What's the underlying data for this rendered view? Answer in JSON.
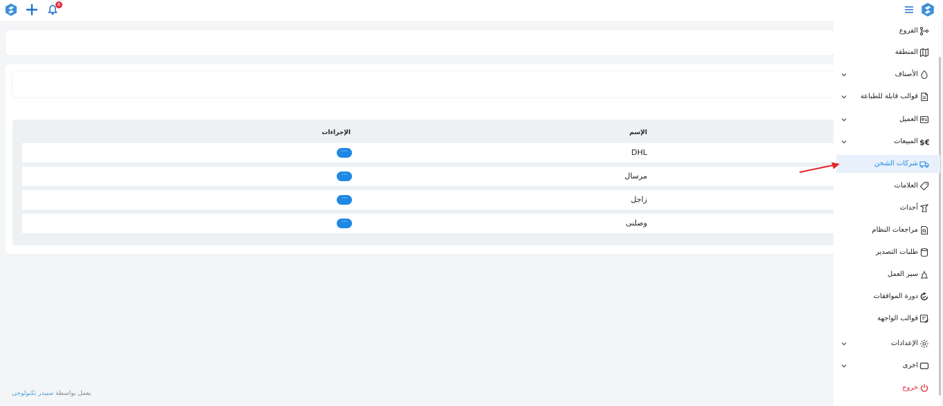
{
  "topbar": {
    "notification_count": "6"
  },
  "table": {
    "headers": {
      "name": "الإسم",
      "actions": "الإجراءات"
    },
    "rows": [
      {
        "name": "DHL",
        "action": "···"
      },
      {
        "name": "مرسال",
        "action": "···"
      },
      {
        "name": "زاجل",
        "action": "···"
      },
      {
        "name": "وصلنى",
        "action": "···"
      }
    ]
  },
  "sidebar": {
    "items": [
      {
        "label": "الفروع",
        "icon": "branches-icon"
      },
      {
        "label": "المنطقة",
        "icon": "map-icon"
      },
      {
        "label": "الأصناف",
        "icon": "category-icon"
      },
      {
        "label": "قوالب قابلة للطباعة",
        "icon": "printable-template-icon"
      },
      {
        "label": "العميل",
        "icon": "customer-icon"
      },
      {
        "label": "المبيعات",
        "icon": "sales-icon"
      },
      {
        "label": "شركات الشحن",
        "icon": "truck-icon"
      },
      {
        "label": "العلامات",
        "icon": "tag-icon"
      },
      {
        "label": "أحداث",
        "icon": "events-icon"
      },
      {
        "label": "مراجعات النظام",
        "icon": "audit-icon"
      },
      {
        "label": "طلبات التصدير",
        "icon": "export-icon"
      },
      {
        "label": "سير العمل",
        "icon": "workflow-icon"
      },
      {
        "label": "دورة الموافقات",
        "icon": "approval-cycle-icon"
      },
      {
        "label": "قوالب الواجهة",
        "icon": "interface-template-icon"
      },
      {
        "label": "الإعدادات",
        "icon": "settings-icon"
      },
      {
        "label": "اخرى",
        "icon": "other-icon"
      },
      {
        "label": "خروج",
        "icon": "power-icon"
      }
    ]
  },
  "footer": {
    "prefix": "يعمل بواسطة",
    "link": "سيبدر تكنولوجى"
  },
  "colors": {
    "accent": "#1e88e5",
    "danger": "#e0283a",
    "annotation_arrow": "#e3262d"
  }
}
